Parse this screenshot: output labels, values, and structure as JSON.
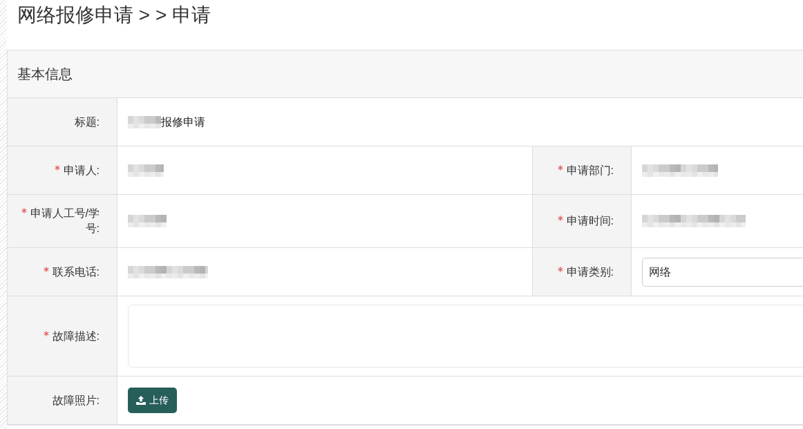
{
  "page_title": "网络报修申请 > > 申请",
  "panel": {
    "title": "基本信息",
    "rows": [
      {
        "fields": [
          {
            "kind": "text",
            "label": "标题:",
            "required": false,
            "redacted": true,
            "value": "报修申请"
          }
        ]
      },
      {
        "fields": [
          {
            "kind": "text",
            "label": "申请人:",
            "required": true,
            "redacted": true
          },
          {
            "kind": "text",
            "label": "申请部门:",
            "required": true,
            "redacted": true
          }
        ]
      },
      {
        "fields": [
          {
            "kind": "text",
            "label": "申请人工号/学号:",
            "required": true,
            "redacted": true
          },
          {
            "kind": "text",
            "label": "申请时间:",
            "required": true,
            "redacted": true
          }
        ]
      },
      {
        "fields": [
          {
            "kind": "text",
            "label": "联系电话:",
            "required": true,
            "redacted": true
          },
          {
            "kind": "select",
            "label": "申请类别:",
            "required": true,
            "value": "网络"
          }
        ]
      },
      {
        "fields": [
          {
            "kind": "textarea",
            "label": "故障描述:",
            "required": true
          }
        ]
      },
      {
        "fields": [
          {
            "kind": "upload",
            "label": "故障照片:",
            "required": false,
            "button": "上传"
          }
        ]
      }
    ]
  }
}
